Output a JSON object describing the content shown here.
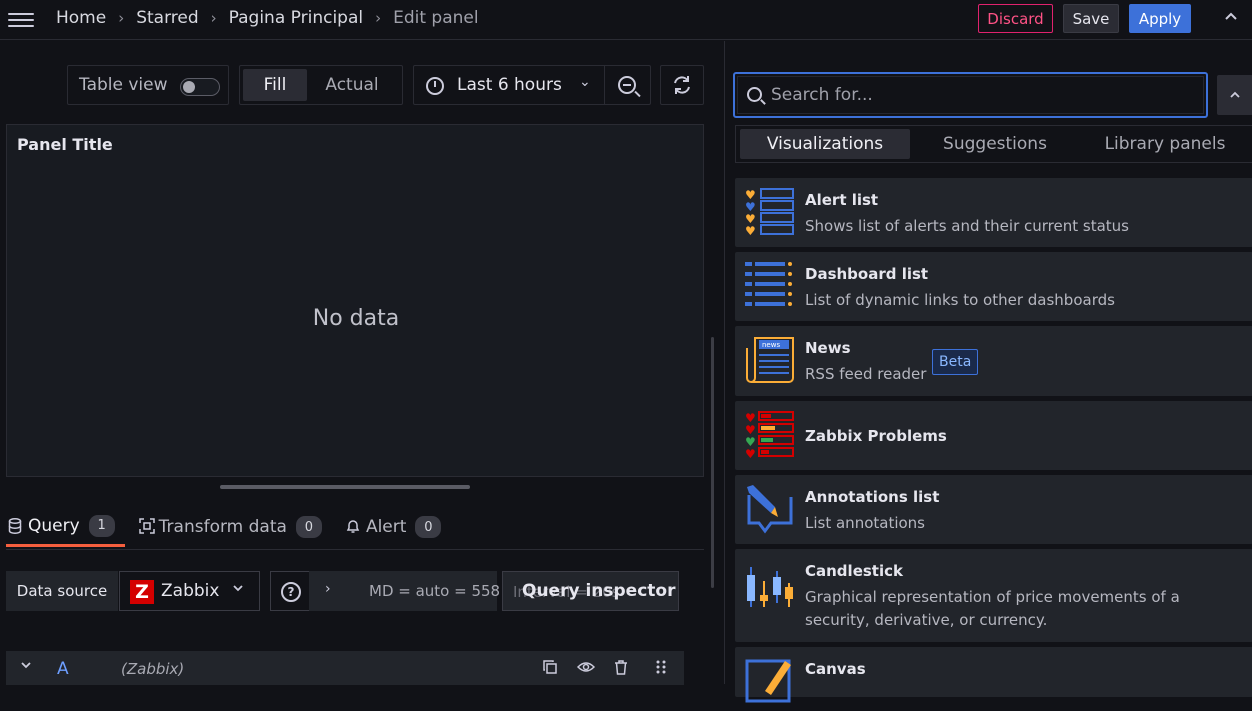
{
  "breadcrumb": [
    "Home",
    "Starred",
    "Pagina Principal",
    "Edit panel"
  ],
  "actions": {
    "discard": "Discard",
    "save": "Save",
    "apply": "Apply"
  },
  "toolbar": {
    "table_view_label": "Table view",
    "table_view_on": false,
    "fill_label": "Fill",
    "actual_label": "Actual",
    "time_range": "Last 6 hours"
  },
  "panel": {
    "title": "Panel Title",
    "empty_text": "No data"
  },
  "query_tabs": [
    {
      "label": "Query",
      "count": "1"
    },
    {
      "label": "Transform data",
      "count": "0"
    },
    {
      "label": "Alert",
      "count": "0"
    }
  ],
  "query": {
    "data_source_label": "Data source",
    "data_source_logo": "Z",
    "data_source_name": "Zabbix",
    "options_text": "MD = auto = 558",
    "options_hidden_text": "Interval = 20s",
    "inspector_label": "Query inspector",
    "row_letter": "A",
    "row_datasource": "(Zabbix)"
  },
  "search": {
    "placeholder": "Search for..."
  },
  "viz_tabs": [
    "Visualizations",
    "Suggestions",
    "Library panels"
  ],
  "visualizations": [
    {
      "title": "Alert list",
      "desc": "Shows list of alerts and their current status",
      "icon": "alert-list-icon"
    },
    {
      "title": "Dashboard list",
      "desc": "List of dynamic links to other dashboards",
      "icon": "dashboard-list-icon"
    },
    {
      "title": "News",
      "desc": "RSS feed reader",
      "icon": "news-icon",
      "badge": "Beta",
      "icon_text": "news"
    },
    {
      "title": "Zabbix Problems",
      "desc": "",
      "icon": "zabbix-problems-icon"
    },
    {
      "title": "Annotations list",
      "desc": "List annotations",
      "icon": "annotations-list-icon"
    },
    {
      "title": "Candlestick",
      "desc": "Graphical representation of price movements of a security, derivative, or currency.",
      "icon": "candlestick-icon"
    },
    {
      "title": "Canvas",
      "desc": "",
      "icon": "canvas-icon"
    }
  ],
  "colors": {
    "accent": "#3d71d9",
    "discard": "#e0226e",
    "tab_active": "#f55f3e",
    "yellow": "#fbad37",
    "blue": "#3d71d9",
    "red": "#d40000",
    "green": "#35a853"
  }
}
